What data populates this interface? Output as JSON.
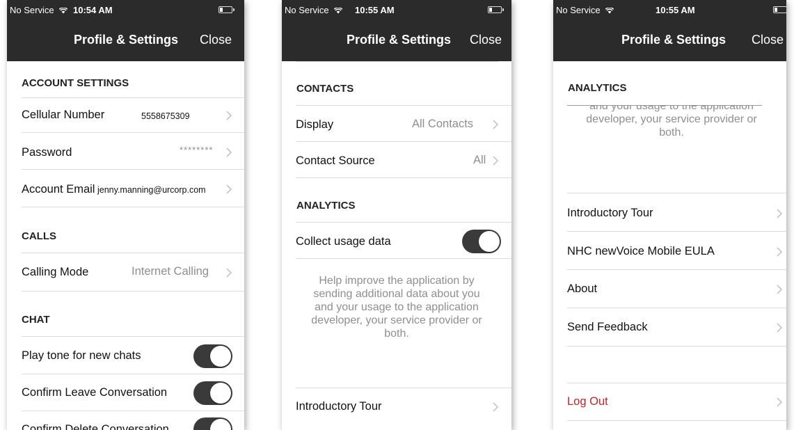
{
  "status_bar": {
    "carrier": "No Service",
    "times": [
      "10:54 AM",
      "10:55 AM",
      "10:55 AM"
    ]
  },
  "nav": {
    "title": "Profile & Settings",
    "close": "Close"
  },
  "screen1": {
    "account_settings": {
      "header": "ACCOUNT SETTINGS",
      "cellular_label": "Cellular Number",
      "cellular_value": "5558675309",
      "password_label": "Password",
      "password_value": "********",
      "email_label": "Account Email",
      "email_value": "jenny.manning@urcorp.com"
    },
    "calls": {
      "header": "CALLS",
      "calling_mode_label": "Calling Mode",
      "calling_mode_value": "Internet Calling"
    },
    "chat": {
      "header": "CHAT",
      "play_tone": "Play tone for new chats",
      "confirm_leave": "Confirm Leave Conversation",
      "confirm_delete": "Confirm Delete Conversation",
      "play_tone_on": true,
      "confirm_leave_on": true,
      "confirm_delete_on": true
    }
  },
  "screen2": {
    "contacts": {
      "header": "CONTACTS",
      "display_label": "Display",
      "display_value": "All Contacts",
      "source_label": "Contact Source",
      "source_value": "All"
    },
    "analytics": {
      "header": "ANALYTICS",
      "collect_label": "Collect usage data",
      "collect_on": true,
      "help_text": [
        "Help improve the application by",
        "sending additional data about you",
        "and your usage to the application",
        "developer, your service provider or",
        "both."
      ]
    },
    "intro_tour": "Introductory Tour"
  },
  "screen3": {
    "analytics_header": "ANALYTICS",
    "help_text_tail": [
      "and your usage to the application",
      "developer, your service provider or",
      "both."
    ],
    "links": {
      "intro_tour": "Introductory Tour",
      "eula": "NHC newVoice Mobile EULA",
      "about": "About",
      "feedback": "Send Feedback"
    },
    "log_out": "Log Out"
  },
  "colors": {
    "nav_bg": "#2b2b2b",
    "toggle_on": "#3a3a3a",
    "logout": "#c8202a",
    "secondary_text": "#8e8e93"
  }
}
